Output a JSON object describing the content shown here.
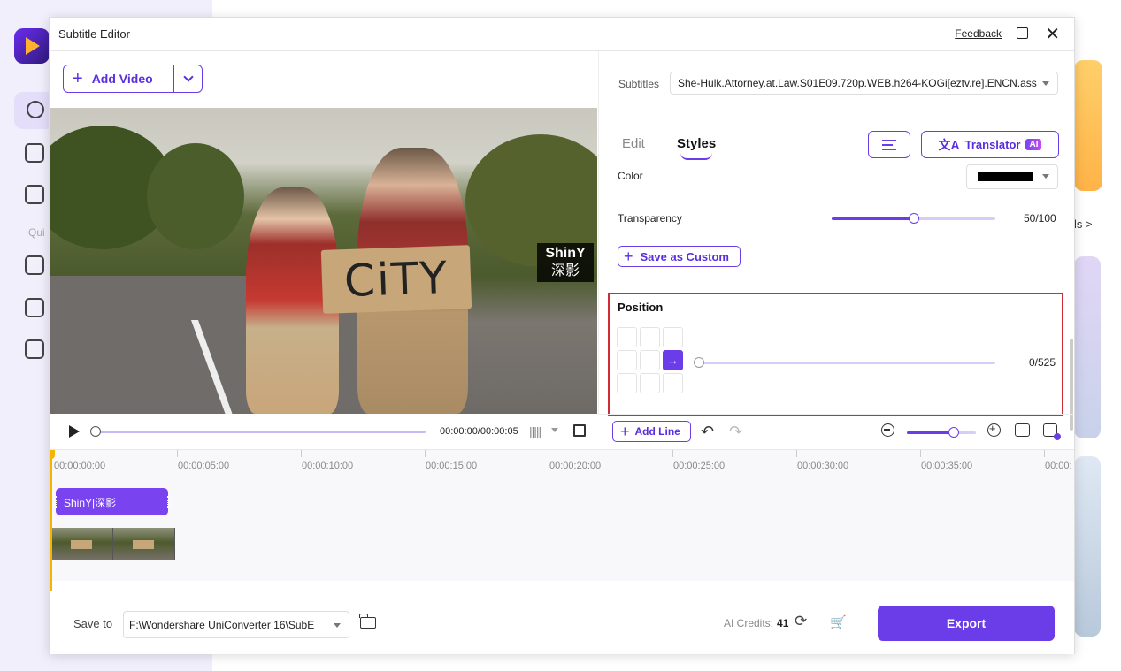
{
  "background": {
    "sidebar_quick_label": "Qui",
    "right_peek_text": "ls >"
  },
  "dialog": {
    "title": "Subtitle Editor",
    "feedback_label": "Feedback"
  },
  "toolbar": {
    "add_video_label": "Add Video"
  },
  "preview": {
    "sign_text": "CiTY",
    "watermark_line1": "ShinY",
    "watermark_line2": "深影"
  },
  "player": {
    "time_display": "00:00:00/00:00:05"
  },
  "right_panel": {
    "subtitles_label": "Subtitles",
    "subtitles_file": "She-Hulk.Attorney.at.Law.S01E09.720p.WEB.h264-KOGi[eztv.re].ENCN.ass",
    "tabs": [
      {
        "label": "Edit",
        "active": false
      },
      {
        "label": "Styles",
        "active": true
      }
    ],
    "translator_label": "Translator",
    "ai_badge": "AI",
    "color_label": "Color",
    "color_value": "#000000",
    "transparency_label": "Transparency",
    "transparency_value": "50/100",
    "transparency_fraction": 0.5,
    "save_custom_label": "Save as Custom",
    "position": {
      "title": "Position",
      "value": "0/525",
      "fraction": 0,
      "selected_cell": "middle-right"
    }
  },
  "timeline_toolbar": {
    "add_line_label": "Add Line",
    "zoom_fraction": 0.68
  },
  "timeline": {
    "ticks": [
      "00:00:00:00",
      "00:00:05:00",
      "00:00:10:00",
      "00:00:15:00",
      "00:00:20:00",
      "00:00:25:00",
      "00:00:30:00",
      "00:00:35:00",
      "00:00:"
    ],
    "subtitle_clip_text": "ShinY|深影"
  },
  "footer": {
    "save_to_label": "Save to",
    "save_path": "F:\\Wondershare UniConverter 16\\SubE",
    "ai_credits_label": "AI Credits:",
    "ai_credits_value": "41",
    "export_label": "Export"
  },
  "colors": {
    "accent": "#6a3de8",
    "highlight_border": "#d12b35",
    "playhead": "#f5b400"
  }
}
